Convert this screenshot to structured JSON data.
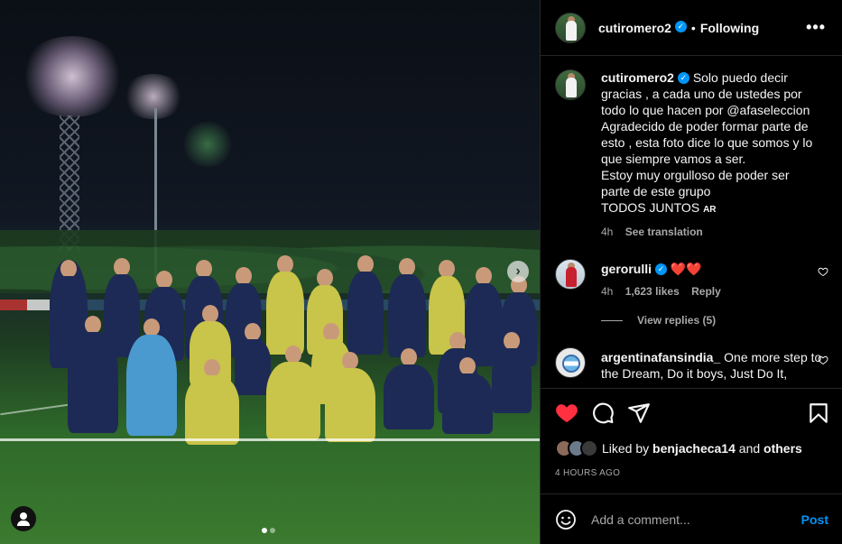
{
  "post": {
    "author": "cutiromero2",
    "follow_state": "Following",
    "separator": "•",
    "more_icon": "more-horizontal-icon"
  },
  "caption": {
    "username": "cutiromero2",
    "lines": [
      "Solo puedo decir",
      "gracias , a cada uno de ustedes por",
      "todo lo que hacen por @afaseleccion",
      "Agradecido de poder formar parte de",
      "esto , esta foto dice lo que somos y lo",
      "que siempre vamos a ser.",
      "Estoy muy orgulloso de poder ser",
      "parte de este grupo",
      "TODOS JUNTOS"
    ],
    "flag": "AR",
    "time": "4h",
    "see_translation": "See translation"
  },
  "comments": [
    {
      "username": "gerorulli",
      "text": "❤️❤️",
      "time": "4h",
      "likes": "1,623 likes",
      "reply": "Reply",
      "view_replies": "View replies (5)"
    },
    {
      "username": "argentinafansindia_",
      "text": "One more step to the Dream, Do it boys, Just Do It,"
    }
  ],
  "actions": {
    "like_icon": "heart-filled-icon",
    "comment_icon": "comment-icon",
    "share_icon": "send-icon",
    "save_icon": "bookmark-icon",
    "liked_by_prefix": "Liked by",
    "liked_by_user": "benjacheca14",
    "liked_by_and": "and",
    "liked_by_others": "others",
    "timestamp": "4 HOURS AGO"
  },
  "add_comment": {
    "placeholder": "Add a comment...",
    "post_label": "Post"
  },
  "carousel": {
    "next_icon": "›",
    "slides": 2,
    "active_slide": 1
  },
  "colors": {
    "accent": "#0095f6",
    "like_red": "#ff3040",
    "background": "#000000"
  }
}
